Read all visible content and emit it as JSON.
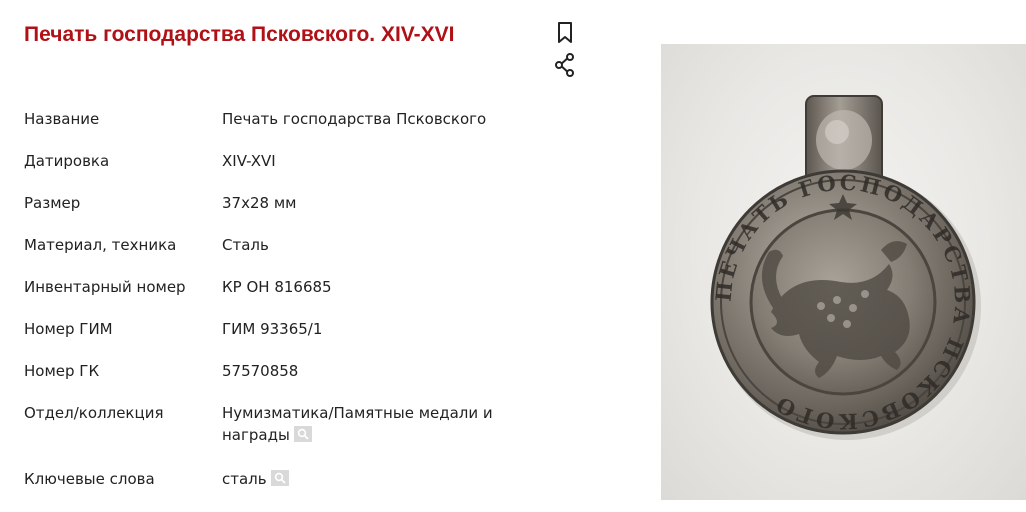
{
  "page": {
    "title": "Печать господарства Псковского. XIV-XVI"
  },
  "actions": {
    "bookmark_icon": "bookmark-icon",
    "share_icon": "share-icon"
  },
  "properties": [
    {
      "label": "Название",
      "value": "Печать господарства Псковского",
      "searchable": false
    },
    {
      "label": "Датировка",
      "value": "XIV-XVI",
      "searchable": false
    },
    {
      "label": "Размер",
      "value": "37x28 мм",
      "searchable": false
    },
    {
      "label": "Материал, техника",
      "value": "Сталь",
      "searchable": false
    },
    {
      "label": "Инвентарный номер",
      "value": "КР ОН 816685",
      "searchable": false
    },
    {
      "label": "Номер ГИМ",
      "value": "ГИМ 93365/1",
      "searchable": false
    },
    {
      "label": "Номер ГК",
      "value": "57570858",
      "searchable": false
    },
    {
      "label": "Отдел/коллекция",
      "value": "Нумизматика/Памятные медали и награды",
      "searchable": true
    },
    {
      "label": "Ключевые слова",
      "value": "сталь",
      "searchable": true
    }
  ],
  "photo": {
    "legend_text": "ПЕЧАТЬ ГОСПОДАРСТВА ПСКОВСКОГО"
  },
  "colors": {
    "title": "#b01116",
    "search_chip": "#d9d9d9"
  }
}
